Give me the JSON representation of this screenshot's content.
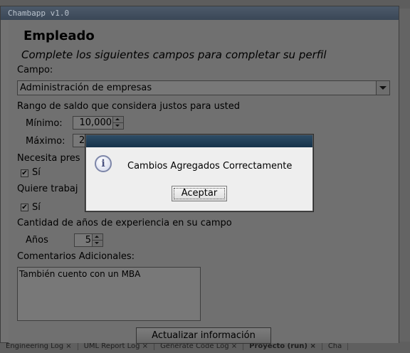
{
  "window": {
    "title": "Chambapp v1.0"
  },
  "form": {
    "heading": "Empleado",
    "subheading": "Complete los siguientes campos para completar su perfil",
    "field_label": "Campo:",
    "field_value": "Administración de empresas",
    "salary_range_label": "Rango de saldo que considera justos para usted",
    "min_label": "Mínimo:",
    "min_value": "10,000",
    "max_label": "Máximo:",
    "max_value": "2",
    "needs_label": "Necesita pres",
    "needs_checkbox_label": "Sí",
    "needs_checked": true,
    "wants_label": "Quiere trabaj",
    "wants_checkbox_label": "Sí",
    "wants_checked": true,
    "experience_label": "Cantidad de años de experiencia en su campo",
    "years_label": "Años",
    "years_value": "5",
    "comments_label": "Comentarios Adicionales:",
    "comments_value": "También cuento con un MBA",
    "update_button": "Actualizar información"
  },
  "dialog": {
    "message": "Cambios Agregados Correctamente",
    "ok_button": "Aceptar",
    "icon": "info-icon"
  },
  "background": {
    "bottom_tabs": [
      "Engineering Log ×",
      "UML Report Log ×",
      "Generate Code Log ×",
      "Proyecto (run) ×",
      "Cha"
    ]
  },
  "colors": {
    "dialog_title": "#16324a",
    "overlay": "#707070"
  }
}
